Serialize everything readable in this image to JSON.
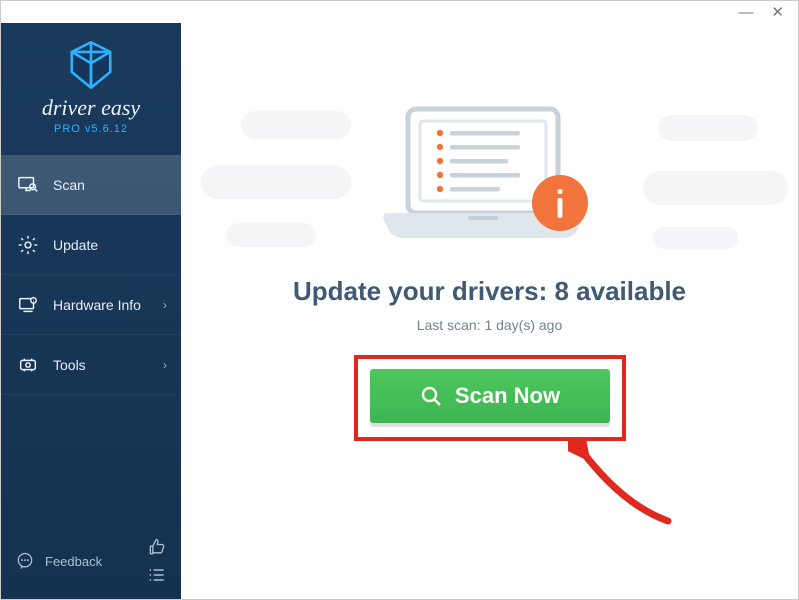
{
  "window": {
    "minimize": "—",
    "close": "✕"
  },
  "brand": {
    "name": "driver easy",
    "version": "PRO v5.6.12"
  },
  "sidebar": {
    "items": [
      {
        "label": "Scan",
        "icon": "monitor-search-icon",
        "chevron": false,
        "active": true
      },
      {
        "label": "Update",
        "icon": "gear-icon",
        "chevron": false,
        "active": false
      },
      {
        "label": "Hardware Info",
        "icon": "hardware-icon",
        "chevron": true,
        "active": false
      },
      {
        "label": "Tools",
        "icon": "tools-icon",
        "chevron": true,
        "active": false
      }
    ],
    "feedback_label": "Feedback"
  },
  "main": {
    "headline": "Update your drivers: 8 available",
    "subline": "Last scan: 1 day(s) ago",
    "scan_button": "Scan Now",
    "info_badge": "i"
  },
  "colors": {
    "sidebar_bg": "#163353",
    "accent_green": "#46bf56",
    "highlight_red": "#e0281f",
    "info_orange": "#f1743d",
    "brand_blue": "#2db1ff",
    "headline": "#3f5a72"
  }
}
